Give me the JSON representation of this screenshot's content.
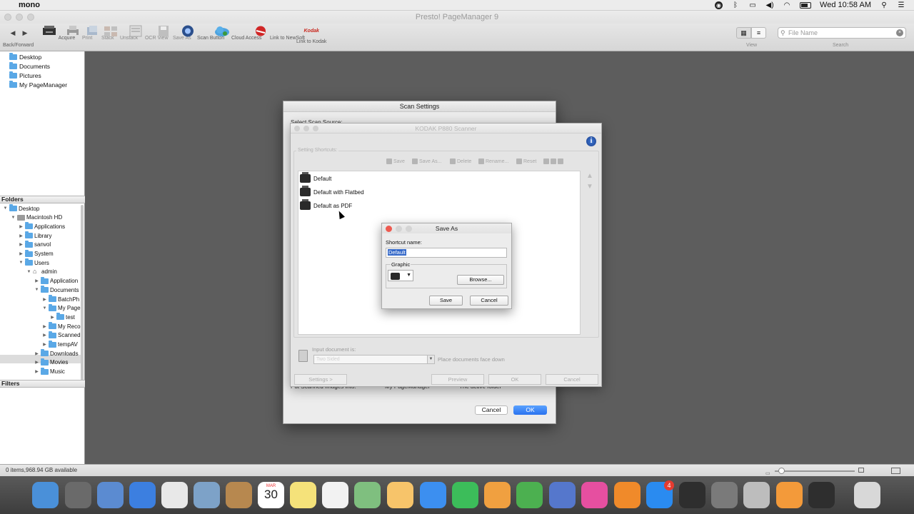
{
  "menubar": {
    "app_name": "mono",
    "clock": "Wed 10:58 AM"
  },
  "window": {
    "title": "Presto! PageManager 9"
  },
  "toolbar": {
    "items": [
      {
        "label": "Back/Forward",
        "icon": "back-forward-icon",
        "enabled": true
      },
      {
        "label": "Acquire",
        "icon": "acquire-icon",
        "enabled": true
      },
      {
        "label": "Print",
        "icon": "print-icon",
        "enabled": false
      },
      {
        "label": "Stack",
        "icon": "stack-icon",
        "enabled": false
      },
      {
        "label": "Unstack",
        "icon": "unstack-icon",
        "enabled": false
      },
      {
        "label": "OCR View",
        "icon": "ocr-view-icon",
        "enabled": false
      },
      {
        "label": "Save As",
        "icon": "save-as-icon",
        "enabled": false
      },
      {
        "label": "Scan Button",
        "icon": "scan-button-icon",
        "enabled": true
      },
      {
        "label": "Cloud Access",
        "icon": "cloud-access-icon",
        "enabled": true
      },
      {
        "label": "Link to NewSoft",
        "icon": "newsoft-icon",
        "enabled": true
      },
      {
        "label": "Link to Kodak",
        "icon": "kodak-icon",
        "enabled": true
      }
    ],
    "kodak_logo": "Kodak",
    "view_label": "View",
    "search_placeholder": "File Name",
    "search_label": "Search"
  },
  "favorites": [
    "Desktop",
    "Documents",
    "Pictures",
    "My PageManager"
  ],
  "folders": {
    "header": "Folders",
    "tree": [
      {
        "label": "Desktop",
        "depth": 0,
        "expanded": true
      },
      {
        "label": "Macintosh HD",
        "depth": 1,
        "expanded": true,
        "type": "drive"
      },
      {
        "label": "Applications",
        "depth": 2
      },
      {
        "label": "Library",
        "depth": 2
      },
      {
        "label": "sanvol",
        "depth": 2
      },
      {
        "label": "System",
        "depth": 2
      },
      {
        "label": "Users",
        "depth": 2,
        "expanded": true
      },
      {
        "label": "admin",
        "depth": 3,
        "expanded": true,
        "type": "home"
      },
      {
        "label": "Application",
        "depth": 4
      },
      {
        "label": "Documents",
        "depth": 4,
        "expanded": true
      },
      {
        "label": "BatchPh",
        "depth": 5
      },
      {
        "label": "My Page",
        "depth": 5,
        "expanded": true,
        "selected": true
      },
      {
        "label": "test",
        "depth": 6
      },
      {
        "label": "My Reco",
        "depth": 5
      },
      {
        "label": "Scanned",
        "depth": 5
      },
      {
        "label": "tempAV",
        "depth": 5
      },
      {
        "label": "Downloads",
        "depth": 4
      },
      {
        "label": "Movies",
        "depth": 4
      },
      {
        "label": "Music",
        "depth": 4
      }
    ]
  },
  "filters": {
    "header": "Filters"
  },
  "statusbar": {
    "text": "0 items,968.94 GB available"
  },
  "scan_settings": {
    "title": "Scan Settings",
    "ghost_top": "Select Scan Source:",
    "ghost_bottom": "Put Scanned Images into:",
    "ghost_radio1": "My PageManager",
    "ghost_radio2": "The active folder",
    "cancel": "Cancel",
    "ok": "OK"
  },
  "kodak_dialog": {
    "title": "KODAK P880 Scanner",
    "shortcuts_label": "Setting Shortcuts:",
    "tools": [
      "Save",
      "Save As...",
      "Delete",
      "Rename...",
      "Reset"
    ],
    "shortcuts": [
      "Default",
      "Default with Flatbed",
      "Default as PDF"
    ],
    "input_doc_label": "Input document is:",
    "input_doc_value": "Two Sided",
    "face_down": "Place documents face down",
    "buttons": {
      "settings": "Settings >",
      "preview": "Preview",
      "ok": "OK",
      "cancel": "Cancel"
    }
  },
  "save_as": {
    "title": "Save As",
    "name_label": "Shortcut name:",
    "name_value": "Default",
    "graphic_label": "Graphic",
    "browse": "Browse...",
    "save": "Save",
    "cancel": "Cancel"
  },
  "dock": {
    "apps": [
      "Finder",
      "Launchpad",
      "Preview",
      "Safari",
      "Chrome",
      "Mail Scanner",
      "Contacts",
      "Calendar",
      "Notes",
      "Reminders",
      "Maps",
      "Photos",
      "Messages",
      "FaceTime",
      "Pages",
      "Numbers",
      "Keynote",
      "iTunes",
      "iBooks",
      "App Store",
      "Nuke",
      "System Preferences",
      "Image Capture",
      "PageManager",
      "Scanner",
      "Trash"
    ],
    "calendar_month": "MAR",
    "calendar_day": "30",
    "appstore_badge": "4"
  }
}
